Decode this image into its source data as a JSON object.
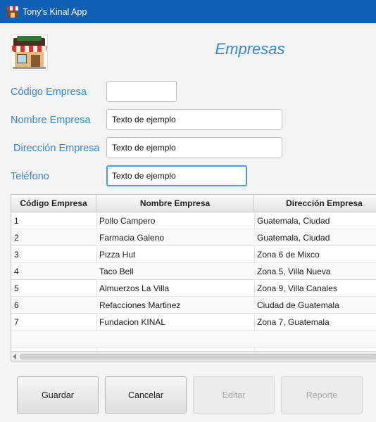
{
  "window": {
    "title": "Tony's Kinal App"
  },
  "header": {
    "title": "Empresas"
  },
  "form": {
    "codigo": {
      "label": "Código Empresa",
      "value": ""
    },
    "nombre": {
      "label": "Nombre Empresa",
      "value": "Texto de ejemplo"
    },
    "direccion": {
      "label": "Dirección Empresa",
      "value": "Texto de ejemplo"
    },
    "telefono": {
      "label": "Teléfono",
      "value": "Texto de ejemplo"
    }
  },
  "table": {
    "columns": [
      "Código Empresa",
      "Nombre Empresa",
      "Dirección Empresa"
    ],
    "rows": [
      [
        "1",
        "Pollo Campero",
        "Guatemala, Ciudad"
      ],
      [
        "2",
        "Farmacia Galeno",
        "Guatemala, Ciudad"
      ],
      [
        "3",
        "Pizza Hut",
        "Zona 6 de Mixco"
      ],
      [
        "4",
        "Taco Bell",
        "Zona 5, Villa Nueva"
      ],
      [
        "5",
        "Almuerzos La Villa",
        "Zona 9, Villa Canales"
      ],
      [
        "6",
        "Refacciones Martinez",
        "Ciudad de Guatemala"
      ],
      [
        "7",
        "Fundacion KINAL",
        "Zona 7, Guatemala"
      ]
    ]
  },
  "buttons": {
    "guardar": "Guardar",
    "cancelar": "Cancelar",
    "editar": "Editar",
    "reporte": "Reporte"
  },
  "colors": {
    "titlebar": "#0f5fb4",
    "accent": "#3a86c8",
    "focus_border": "#4d9ae0"
  }
}
